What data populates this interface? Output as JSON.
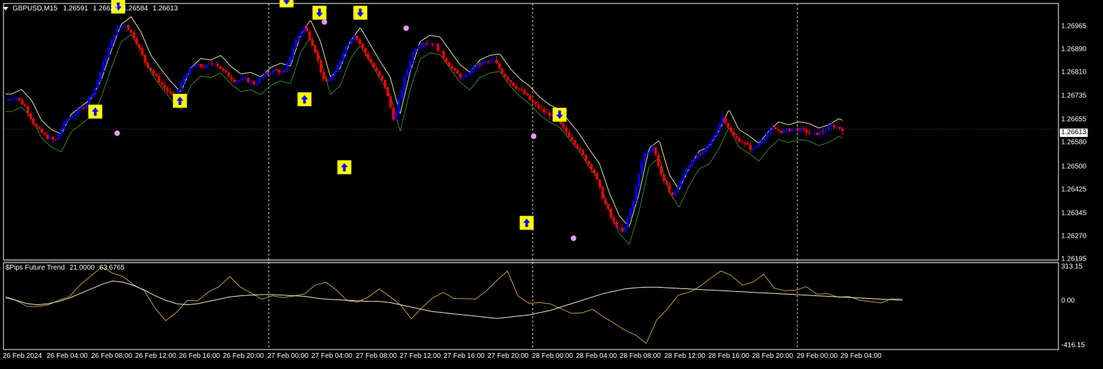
{
  "header": {
    "symbol_timeframe": "GBPUSD,M15",
    "ohlc": [
      "1.26591",
      "1.26624",
      "1.26584",
      "1.26613"
    ]
  },
  "indicator": {
    "name": "$Pips Future Trend",
    "params": [
      "21.0000",
      "63.6765"
    ],
    "y_labels": [
      "313.15",
      "0.00",
      "-416.15"
    ]
  },
  "price_axis": {
    "labels": [
      "1.26965",
      "1.26890",
      "1.26810",
      "1.26735",
      "1.26655",
      "1.26580",
      "1.26500",
      "1.26425",
      "1.26345",
      "1.26270",
      "1.26195"
    ],
    "current_price": "1.26613"
  },
  "time_axis": {
    "labels": [
      "26 Feb 2024",
      "26 Feb 04:00",
      "26 Feb 08:00",
      "26 Feb 12:00",
      "26 Feb 16:00",
      "26 Feb 20:00",
      "27 Feb 00:00",
      "27 Feb 04:00",
      "27 Feb 08:00",
      "27 Feb 12:00",
      "27 Feb 16:00",
      "27 Feb 20:00",
      "28 Feb 00:00",
      "28 Feb 04:00",
      "28 Feb 08:00",
      "28 Feb 12:00",
      "28 Feb 16:00",
      "28 Feb 20:00",
      "29 Feb 00:00",
      "29 Feb 04:00"
    ]
  },
  "colors": {
    "background": "#000000",
    "bull": "#0000ff",
    "bear": "#ff0000",
    "band_upper": "#e8e8a0",
    "band_lower": "#2e8b2e",
    "signal_bg": "#ffff00",
    "signal_arrow": "#0000ff",
    "oscillator": "#c8a040",
    "oscillator_ma": "#f0f0d0",
    "grid_dash": "#ffffff"
  },
  "chart_data": {
    "type": "candlestick",
    "symbol": "GBPUSD",
    "timeframe": "M15",
    "ylim": [
      1.2619,
      1.2702
    ],
    "price_path": [
      [
        0,
        1.26705
      ],
      [
        1,
        1.2672
      ],
      [
        2,
        1.26685
      ],
      [
        3,
        1.2662
      ],
      [
        4,
        1.2659
      ],
      [
        5,
        1.26575
      ],
      [
        6,
        1.2664
      ],
      [
        7,
        1.26665
      ],
      [
        8,
        1.2669
      ],
      [
        9,
        1.2675
      ],
      [
        10,
        1.26845
      ],
      [
        11,
        1.2693
      ],
      [
        12,
        1.26955
      ],
      [
        13,
        1.26905
      ],
      [
        14,
        1.2683
      ],
      [
        15,
        1.26785
      ],
      [
        16,
        1.26745
      ],
      [
        17,
        1.2671
      ],
      [
        18,
        1.2679
      ],
      [
        19,
        1.2682
      ],
      [
        20,
        1.26815
      ],
      [
        21,
        1.2683
      ],
      [
        22,
        1.26795
      ],
      [
        23,
        1.2677
      ],
      [
        24,
        1.26775
      ],
      [
        25,
        1.2676
      ],
      [
        26,
        1.2679
      ],
      [
        27,
        1.26805
      ],
      [
        28,
        1.26795
      ],
      [
        29,
        1.26895
      ],
      [
        30,
        1.26945
      ],
      [
        31,
        1.26875
      ],
      [
        32,
        1.2676
      ],
      [
        33,
        1.2679
      ],
      [
        34,
        1.26875
      ],
      [
        35,
        1.2692
      ],
      [
        36,
        1.26865
      ],
      [
        37,
        1.2681
      ],
      [
        38,
        1.2676
      ],
      [
        39,
        1.2664
      ],
      [
        40,
        1.26775
      ],
      [
        41,
        1.26875
      ],
      [
        42,
        1.26895
      ],
      [
        43,
        1.2689
      ],
      [
        44,
        1.26845
      ],
      [
        45,
        1.268
      ],
      [
        46,
        1.26775
      ],
      [
        47,
        1.26815
      ],
      [
        48,
        1.2683
      ],
      [
        49,
        1.26835
      ],
      [
        50,
        1.2679
      ],
      [
        51,
        1.26755
      ],
      [
        52,
        1.2673
      ],
      [
        53,
        1.26695
      ],
      [
        54,
        1.2667
      ],
      [
        55,
        1.26655
      ],
      [
        56,
        1.26615
      ],
      [
        57,
        1.26575
      ],
      [
        58,
        1.26525
      ],
      [
        59,
        1.2648
      ],
      [
        60,
        1.26385
      ],
      [
        61,
        1.2631
      ],
      [
        62,
        1.26275
      ],
      [
        63,
        1.26385
      ],
      [
        64,
        1.2653
      ],
      [
        65,
        1.26555
      ],
      [
        66,
        1.26445
      ],
      [
        67,
        1.26395
      ],
      [
        68,
        1.26465
      ],
      [
        69,
        1.2652
      ],
      [
        70,
        1.26535
      ],
      [
        71,
        1.26585
      ],
      [
        72,
        1.26655
      ],
      [
        73,
        1.2659
      ],
      [
        74,
        1.2657
      ],
      [
        75,
        1.26545
      ],
      [
        76,
        1.26585
      ],
      [
        77,
        1.26615
      ],
      [
        78,
        1.26605
      ],
      [
        79,
        1.26615
      ],
      [
        80,
        1.2661
      ],
      [
        81,
        1.26595
      ],
      [
        82,
        1.26605
      ],
      [
        83,
        1.26625
      ],
      [
        84,
        1.26613
      ]
    ],
    "signals": [
      {
        "dir": "up",
        "t": 9,
        "price": 1.2667
      },
      {
        "dir": "down",
        "t": 11.3,
        "price": 1.2701
      },
      {
        "dir": "up",
        "t": 17.5,
        "price": 1.26705
      },
      {
        "dir": "down",
        "t": 28.2,
        "price": 1.2703
      },
      {
        "dir": "up",
        "t": 30,
        "price": 1.2671
      },
      {
        "dir": "down",
        "t": 31.5,
        "price": 1.2699
      },
      {
        "dir": "up",
        "t": 34,
        "price": 1.2649
      },
      {
        "dir": "down",
        "t": 35.6,
        "price": 1.2699
      },
      {
        "dir": "down",
        "t": 55.6,
        "price": 1.2666
      },
      {
        "dir": "up",
        "t": 52.3,
        "price": 1.2631
      }
    ],
    "oscillator": {
      "ylim": [
        -416.15,
        313.15
      ],
      "values": [
        20,
        -10,
        -40,
        -60,
        -30,
        0,
        40,
        120,
        220,
        280,
        240,
        200,
        150,
        80,
        -60,
        -180,
        -100,
        -20,
        0,
        60,
        120,
        200,
        130,
        60,
        20,
        40,
        30,
        20,
        60,
        120,
        160,
        80,
        10,
        -20,
        40,
        100,
        40,
        -60,
        -160,
        -80,
        20,
        60,
        30,
        10,
        20,
        80,
        180,
        240,
        40,
        -40,
        -20,
        -40,
        -60,
        -120,
        -100,
        -80,
        -140,
        -220,
        -260,
        -320,
        -380,
        -180,
        -60,
        40,
        80,
        120,
        200,
        240,
        220,
        120,
        160,
        220,
        120,
        80,
        100,
        120,
        60,
        40,
        30,
        20,
        0,
        -20,
        -10,
        10,
        20
      ],
      "ma_values": [
        30,
        0,
        -30,
        -40,
        -30,
        -10,
        20,
        60,
        100,
        140,
        170,
        160,
        130,
        90,
        40,
        0,
        -30,
        -40,
        -30,
        -10,
        10,
        30,
        40,
        45,
        50,
        50,
        45,
        40,
        35,
        20,
        10,
        5,
        0,
        -5,
        -10,
        -10,
        -20,
        -40,
        -60,
        -80,
        -100,
        -110,
        -120,
        -130,
        -140,
        -150,
        -160,
        -150,
        -140,
        -130,
        -110,
        -90,
        -60,
        -30,
        0,
        30,
        60,
        80,
        100,
        110,
        115,
        115,
        110,
        105,
        100,
        95,
        90,
        85,
        80,
        75,
        70,
        65,
        60,
        55,
        50,
        45,
        40,
        35,
        30,
        25,
        20,
        15,
        10,
        5,
        0
      ]
    }
  }
}
